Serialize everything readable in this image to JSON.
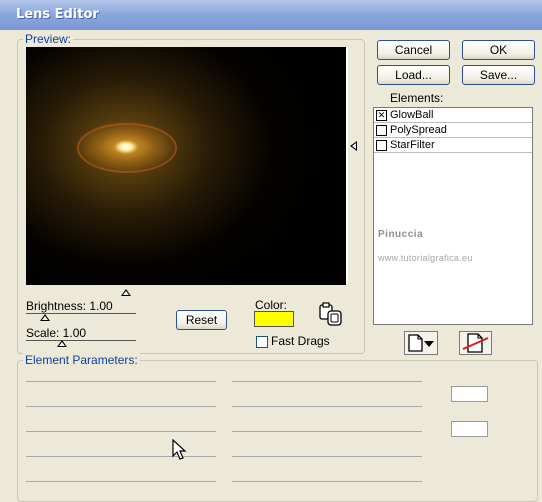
{
  "window": {
    "title": "Lens Editor"
  },
  "preview": {
    "legend": "Preview:"
  },
  "buttons": {
    "cancel": "Cancel",
    "ok": "OK",
    "load": "Load...",
    "save": "Save...",
    "reset": "Reset"
  },
  "controls": {
    "brightness_label": "Brightness: 1.00",
    "scale_label": "Scale: 1.00",
    "color_label": "Color:",
    "color_value": "#ffff00",
    "fast_drags_label": "Fast Drags",
    "fast_drags_checked": false
  },
  "elements": {
    "label": "Elements:",
    "items": [
      {
        "label": "GlowBall",
        "checked": true
      },
      {
        "label": "PolySpread",
        "checked": false
      },
      {
        "label": "StarFilter",
        "checked": false
      }
    ]
  },
  "parameters": {
    "legend": "Element Parameters:"
  },
  "watermark": {
    "line1": "Pinuccia",
    "line2": "www.tutorialgrafica.eu"
  },
  "icons": {
    "new_element": "new-document-dropdown-icon",
    "delete_element": "delete-document-icon",
    "clipboard": "clipboard-copy-icon"
  }
}
